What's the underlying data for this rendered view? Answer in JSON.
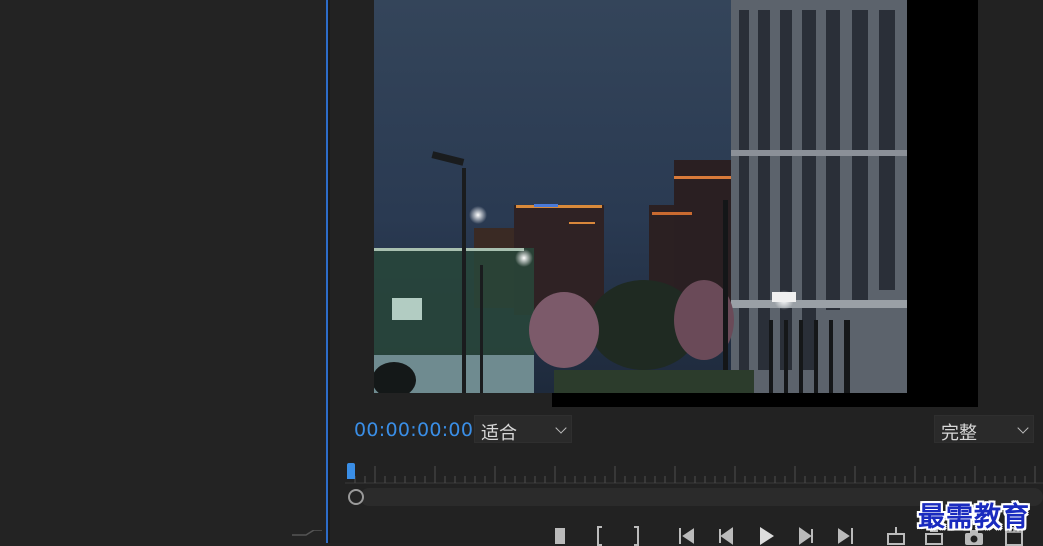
{
  "program_monitor": {
    "timecode": "00:00:00:00",
    "zoom_select": {
      "value": "适合"
    },
    "quality_select": {
      "value": "完整"
    },
    "accent_color": "#3a8ee6",
    "preview_description_icon": "night-city-video-frame"
  },
  "transport_controls": [
    {
      "icon": "add-marker-icon"
    },
    {
      "icon": "mark-in-icon"
    },
    {
      "icon": "mark-out-icon"
    },
    {
      "icon": "go-to-in-icon"
    },
    {
      "icon": "step-back-icon"
    },
    {
      "icon": "play-icon"
    },
    {
      "icon": "step-forward-icon"
    },
    {
      "icon": "go-to-out-icon"
    },
    {
      "icon": "lift-icon"
    },
    {
      "icon": "extract-icon"
    },
    {
      "icon": "export-frame-icon"
    },
    {
      "icon": "comparison-view-icon"
    }
  ],
  "watermark": {
    "text": "最需教育",
    "color": "#1a2bbf"
  }
}
